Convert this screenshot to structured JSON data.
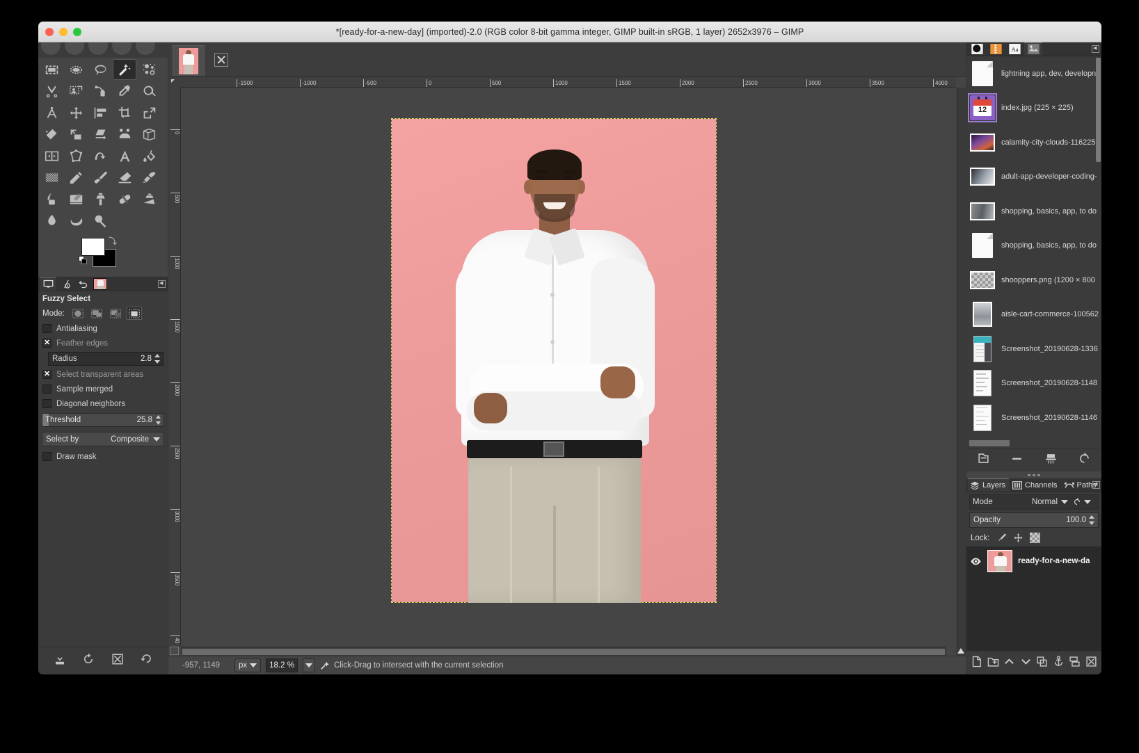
{
  "window": {
    "title": "*[ready-for-a-new-day] (imported)-2.0 (RGB color 8-bit gamma integer, GIMP built-in sRGB, 1 layer) 2652x3976 – GIMP"
  },
  "toolbox": {
    "tools": [
      {
        "name": "rectangle-select-tool",
        "label": "Rectangle Select"
      },
      {
        "name": "ellipse-select-tool",
        "label": "Ellipse Select"
      },
      {
        "name": "free-select-tool",
        "label": "Free Select"
      },
      {
        "name": "fuzzy-select-tool",
        "label": "Fuzzy Select"
      },
      {
        "name": "select-by-color-tool",
        "label": "Select by Color"
      },
      {
        "name": "scissors-select-tool",
        "label": "Scissors Select"
      },
      {
        "name": "foreground-select-tool",
        "label": "Foreground Select"
      },
      {
        "name": "paths-tool",
        "label": "Paths"
      },
      {
        "name": "color-picker-tool",
        "label": "Color Picker"
      },
      {
        "name": "zoom-tool",
        "label": "Zoom"
      },
      {
        "name": "measure-tool",
        "label": "Measure"
      },
      {
        "name": "move-tool",
        "label": "Move"
      },
      {
        "name": "alignment-tool",
        "label": "Alignment"
      },
      {
        "name": "crop-tool",
        "label": "Crop"
      },
      {
        "name": "transform-tool",
        "label": "Transform"
      },
      {
        "name": "rotate-tool",
        "label": "Rotate"
      },
      {
        "name": "scale-tool",
        "label": "Scale"
      },
      {
        "name": "shear-tool",
        "label": "Shear"
      },
      {
        "name": "handle-transform-tool",
        "label": "Handle Transform"
      },
      {
        "name": "perspective-tool",
        "label": "Perspective"
      },
      {
        "name": "flip-tool",
        "label": "Flip"
      },
      {
        "name": "cage-transform-tool",
        "label": "Cage Transform"
      },
      {
        "name": "warp-transform-tool",
        "label": "Warp Transform"
      },
      {
        "name": "text-tool",
        "label": "Text"
      },
      {
        "name": "bucket-fill-tool",
        "label": "Bucket Fill"
      },
      {
        "name": "gradient-tool",
        "label": "Gradient"
      },
      {
        "name": "pencil-tool",
        "label": "Pencil"
      },
      {
        "name": "paintbrush-tool",
        "label": "Paintbrush"
      },
      {
        "name": "eraser-tool",
        "label": "Eraser"
      },
      {
        "name": "airbrush-tool",
        "label": "Airbrush"
      },
      {
        "name": "ink-tool",
        "label": "Ink"
      },
      {
        "name": "mypaint-brush-tool",
        "label": "MyPaint Brush"
      },
      {
        "name": "clone-tool",
        "label": "Clone"
      },
      {
        "name": "heal-tool",
        "label": "Heal"
      },
      {
        "name": "perspective-clone-tool",
        "label": "Perspective Clone"
      },
      {
        "name": "blur-sharpen-tool",
        "label": "Blur / Sharpen"
      },
      {
        "name": "smudge-tool",
        "label": "Smudge"
      },
      {
        "name": "dodge-burn-tool",
        "label": "Dodge / Burn"
      }
    ],
    "active_tool_index": 3,
    "colors": {
      "foreground": "#ffffff",
      "background": "#000000"
    }
  },
  "tool_options": {
    "title": "Fuzzy Select",
    "mode_label": "Mode:",
    "mode_buttons": [
      "replace",
      "add",
      "subtract",
      "intersect"
    ],
    "mode_selected": 3,
    "checkboxes": [
      {
        "label": "Antialiasing",
        "checked": false,
        "dim": false
      },
      {
        "label": "Feather edges",
        "checked": true,
        "dim": true
      },
      {
        "label": "Select transparent areas",
        "checked": true,
        "dim": true
      },
      {
        "label": "Sample merged",
        "checked": false,
        "dim": false
      },
      {
        "label": "Diagonal neighbors",
        "checked": false,
        "dim": false
      }
    ],
    "radius": {
      "label": "Radius",
      "value": "2.8"
    },
    "threshold": {
      "label": "Threshold",
      "value": "25.8"
    },
    "select_by": {
      "label": "Select by",
      "value": "Composite"
    },
    "draw_mask": {
      "label": "Draw mask",
      "checked": false
    },
    "bottom_buttons": [
      "save-tool-preset",
      "restore-tool-preset",
      "delete-tool-preset",
      "reset-tool-options"
    ]
  },
  "canvas": {
    "tab_label": "ready-for-a-new-day",
    "h_ruler_ticks": [
      "-1500",
      "-1000",
      "-500",
      "0",
      "500",
      "1000",
      "1500",
      "2000",
      "2500",
      "3000",
      "3500",
      "4000"
    ],
    "v_ruler_ticks": [
      "0",
      "500",
      "1000",
      "1500",
      "2000",
      "2500",
      "3000",
      "3500",
      "40"
    ]
  },
  "statusbar": {
    "position": "-957, 1149",
    "unit": "px",
    "zoom": "18.2 %",
    "message": "Click-Drag to intersect with the current selection"
  },
  "right_dock": {
    "tabs": [
      "brushes-tab",
      "patterns-tab",
      "fonts-tab",
      "document-history-tab"
    ],
    "selected_tab": 3,
    "files": [
      {
        "name": "lightning app, dev, developn",
        "icon": "document",
        "selected": false
      },
      {
        "name": "index.jpg (225 × 225)",
        "icon": "calendar",
        "selected": true
      },
      {
        "name": "calamity-city-clouds-116225",
        "icon": "image-clouds",
        "selected": false
      },
      {
        "name": "adult-app-developer-coding-",
        "icon": "image-desk",
        "selected": false
      },
      {
        "name": "shopping, basics, app, to do",
        "icon": "image-crowd",
        "selected": false
      },
      {
        "name": "shopping, basics, app, to do",
        "icon": "document",
        "selected": false
      },
      {
        "name": "shooppers.png (1200 × 800",
        "icon": "image-transparent",
        "selected": false
      },
      {
        "name": "aisle-cart-commerce-100562",
        "icon": "image-aisle",
        "selected": false
      },
      {
        "name": "Screenshot_20190628-1336",
        "icon": "screenshot-teal",
        "selected": false
      },
      {
        "name": "Screenshot_20190628-1148",
        "icon": "screenshot-white",
        "selected": false
      },
      {
        "name": "Screenshot_20190628-1146",
        "icon": "screenshot-white2",
        "selected": false
      }
    ],
    "buttons": [
      "open-image-button",
      "remove-entry-button",
      "clear-history-button",
      "refresh-button"
    ]
  },
  "layers_dock": {
    "tabs": [
      {
        "label": "Layers",
        "icon": "layers-icon",
        "selected": true
      },
      {
        "label": "Channels",
        "icon": "channels-icon",
        "selected": false
      },
      {
        "label": "Paths",
        "icon": "paths-icon",
        "selected": false
      }
    ],
    "mode": {
      "label": "Mode",
      "value": "Normal"
    },
    "opacity": {
      "label": "Opacity",
      "value": "100.0"
    },
    "lock": {
      "label": "Lock:",
      "items": [
        "lock-pixels-icon",
        "lock-position-icon",
        "lock-alpha-icon"
      ]
    },
    "layers": [
      {
        "name": "ready-for-a-new-da",
        "visible": true
      }
    ],
    "buttons": [
      "new-layer-button",
      "new-layer-group-button",
      "raise-layer-button",
      "lower-layer-button",
      "duplicate-layer-button",
      "anchor-layer-button",
      "merge-down-button",
      "delete-layer-button"
    ]
  },
  "colors": {
    "accent": "#9b7bd4",
    "panel_bg": "#3b3b3b",
    "window_bg": "#454545",
    "canvas_bg": "#454545",
    "image_pink": "#ec9a9a"
  }
}
